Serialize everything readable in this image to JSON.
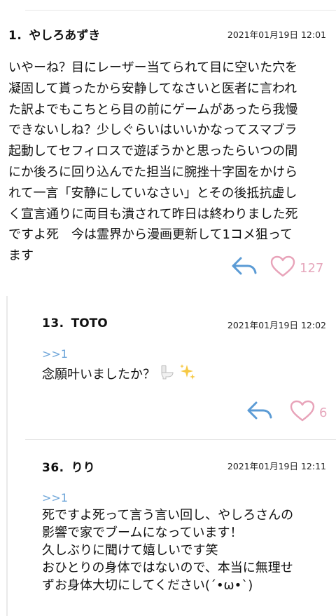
{
  "comments": [
    {
      "number": "1.",
      "author": "やしろあずき",
      "date": "2021年01月19日 12:01",
      "body": "いやーね？目にレーザー当てられて目に空いた穴を\n凝固して貰ったから安静してなさいと医者に言われ\nた訳よでもこちとら目の前にゲームがあったら我慢\nできないしね？少しぐらいはいいかなってスマブラ\n起動してセフィロスで遊ぼうかと思ったらいつの間\nにか後ろに回り込んでた担当に腕挫十字固をかけら\nれて一言「安静にしていなさい」とその後抵抗虚し\nく宣言通りに両目も潰されて昨日は終わりました死\nですよ死　今は霊界から漫画更新して1コメ狙って\nます",
      "likes": "127"
    },
    {
      "number": "13.",
      "author": "TOTO",
      "date": "2021年01月19日 12:02",
      "anchor": ">>1",
      "body": "念願叶いましたか？",
      "emoji": [
        "toilet-emoji",
        "sparkles-emoji"
      ],
      "likes": "6"
    },
    {
      "number": "36.",
      "author": "りり",
      "date": "2021年01月19日 12:11",
      "anchor": ">>1",
      "body": "死ですよ死って言う言い回し、やしろさんの\n影響で家でブームになっています！\n久しぶりに聞けて嬉しいです笑\nおひとりの身体ではないので、本当に無理せ\nずお身体大切にしてください(´•ω•`)"
    }
  ],
  "colors": {
    "reply_icon": "#5b9bd5",
    "heart_icon": "#e8a3b9",
    "anchor": "#6fa6d9",
    "divider": "#e6e6e6"
  },
  "icons": [
    "reply-arrow-icon",
    "heart-icon"
  ]
}
